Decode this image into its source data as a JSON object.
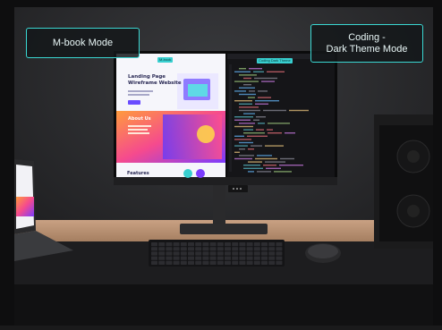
{
  "labels": {
    "left": "M-book Mode",
    "right": "Coding -\nDark Theme Mode"
  },
  "screen": {
    "left_tag": "M-book",
    "right_tag": "Coding Dark Theme",
    "landing_title": "Landing Page\nWireframe Website",
    "about_title": "About Us",
    "features_title": "Features"
  },
  "colors": {
    "accent": "#3ad7d2",
    "wall": "#2a2b2d",
    "desk_wood": "#b99272",
    "mat": "#1b1b1d"
  }
}
